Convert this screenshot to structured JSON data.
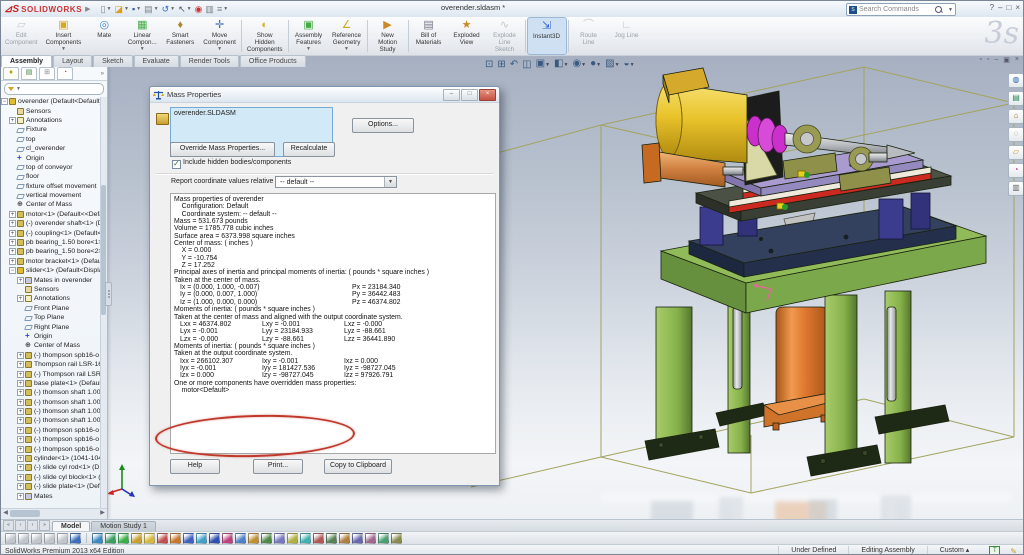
{
  "titlebar": {
    "logo_text": "SOLIDWORKS",
    "document_title": "overender.sldasm *",
    "search_placeholder": "Search Commands",
    "qat": [
      {
        "name": "new-document-icon",
        "dd": true
      },
      {
        "name": "open-document-icon",
        "dd": true
      },
      {
        "name": "save-icon",
        "dd": true
      },
      {
        "name": "print-icon",
        "dd": true
      },
      {
        "name": "undo-icon",
        "dd": true
      },
      {
        "name": "select-arrow-icon",
        "dd": true
      },
      {
        "name": "rebuild-icon",
        "dd": false
      },
      {
        "name": "file-properties-icon",
        "dd": false
      },
      {
        "name": "options-icon",
        "dd": true
      }
    ],
    "window_buttons": [
      {
        "name": "help-icon",
        "g": "?"
      },
      {
        "name": "minimize-icon",
        "g": "–"
      },
      {
        "name": "restore-icon",
        "g": "□"
      },
      {
        "name": "close-icon",
        "g": "×"
      }
    ]
  },
  "ribbon": {
    "brand_mark": "3s",
    "buttons": [
      {
        "label": "Edit\nComponent",
        "icon": "edit-component-icon",
        "enabled": false
      },
      {
        "label": "Insert\nComponents",
        "icon": "insert-components-icon",
        "dd": true
      },
      {
        "label": "Mate",
        "icon": "mate-icon"
      },
      {
        "label": "Linear\nCompon...",
        "icon": "linear-component-pattern-icon",
        "dd": true
      },
      {
        "label": "Smart\nFasteners",
        "icon": "smart-fasteners-icon"
      },
      {
        "label": "Move\nComponent",
        "icon": "move-component-icon",
        "dd": true,
        "sep": true
      },
      {
        "label": "Show\nHidden\nComponents",
        "icon": "show-hidden-components-icon",
        "sep": true
      },
      {
        "label": "Assembly\nFeatures",
        "icon": "assembly-features-icon",
        "dd": true
      },
      {
        "label": "Reference\nGeometry",
        "icon": "reference-geometry-icon",
        "dd": true,
        "sep": true
      },
      {
        "label": "New\nMotion\nStudy",
        "icon": "new-motion-study-icon",
        "sep": true
      },
      {
        "label": "Bill of\nMaterials",
        "icon": "bill-of-materials-icon"
      },
      {
        "label": "Exploded\nView",
        "icon": "exploded-view-icon"
      },
      {
        "label": "Explode\nLine\nSketch",
        "icon": "explode-line-sketch-icon",
        "enabled": false,
        "sep": true
      },
      {
        "label": "Instant3D",
        "icon": "instant3d-icon",
        "active": true,
        "sep": true
      },
      {
        "label": "Route\nLine",
        "icon": "route-line-icon",
        "enabled": false
      },
      {
        "label": "Jog Line",
        "icon": "jog-line-icon",
        "enabled": false
      }
    ]
  },
  "command_tabs": {
    "items": [
      "Assembly",
      "Layout",
      "Sketch",
      "Evaluate",
      "Render Tools",
      "Office Products"
    ],
    "active_index": 0
  },
  "headsup_icons": [
    {
      "name": "zoom-fit-icon",
      "g": "⊡"
    },
    {
      "name": "zoom-area-icon",
      "g": "⊞"
    },
    {
      "name": "previous-view-icon",
      "g": "↶"
    },
    {
      "name": "section-view-icon",
      "g": "◫"
    },
    {
      "name": "view-orientation-icon",
      "g": "▣",
      "dd": true
    },
    {
      "name": "display-style-icon",
      "g": "◧",
      "dd": true
    },
    {
      "name": "hide-show-items-icon",
      "g": "◉",
      "dd": true
    },
    {
      "name": "edit-appearance-icon",
      "g": "●",
      "dd": true
    },
    {
      "name": "apply-scene-icon",
      "g": "▨",
      "dd": true
    },
    {
      "name": "view-settings-icon",
      "g": "◒",
      "dd": true
    }
  ],
  "doc_window_buttons": [
    {
      "name": "new-window-icon",
      "g": "▫"
    },
    {
      "name": "cascade-windows-icon",
      "g": "▫"
    },
    {
      "name": "minimize-doc-icon",
      "g": "–"
    },
    {
      "name": "restore-doc-icon",
      "g": "▣"
    },
    {
      "name": "close-doc-icon",
      "g": "×"
    }
  ],
  "feature_panel": {
    "tabs": [
      "featuremanager-tab-icon",
      "propertymanager-tab-icon",
      "configurationmanager-tab-icon",
      "displaymanager-tab-icon"
    ],
    "tree": [
      {
        "t": "overender (Default<Default_[",
        "d": 0,
        "e": "-",
        "i": "asm"
      },
      {
        "t": "Sensors",
        "d": 1,
        "e": "",
        "i": "folder"
      },
      {
        "t": "Annotations",
        "d": 1,
        "e": "+",
        "i": "ann"
      },
      {
        "t": "Fixture",
        "d": 1,
        "e": "",
        "i": "plane"
      },
      {
        "t": "top",
        "d": 1,
        "e": "",
        "i": "plane"
      },
      {
        "t": "cl_overender",
        "d": 1,
        "e": "",
        "i": "plane"
      },
      {
        "t": "Origin",
        "d": 1,
        "e": "",
        "i": "origin"
      },
      {
        "t": "top of conveyor",
        "d": 1,
        "e": "",
        "i": "plane"
      },
      {
        "t": "floor",
        "d": 1,
        "e": "",
        "i": "plane"
      },
      {
        "t": "fixture offset movement",
        "d": 1,
        "e": "",
        "i": "plane"
      },
      {
        "t": "vertical movement",
        "d": 1,
        "e": "",
        "i": "plane"
      },
      {
        "t": "Center of Mass",
        "d": 1,
        "e": "",
        "i": "com"
      },
      {
        "t": "motor<1> (Default<<Defa",
        "d": 1,
        "e": "+",
        "i": "part"
      },
      {
        "t": "(-) overender shaft<1> (De",
        "d": 1,
        "e": "+",
        "i": "part"
      },
      {
        "t": "(-) coupling<1> (Default<",
        "d": 1,
        "e": "+",
        "i": "part"
      },
      {
        "t": "pb bearing_1.50 bore<1> (",
        "d": 1,
        "e": "+",
        "i": "part"
      },
      {
        "t": "pb bearing_1.50 bore<2> (",
        "d": 1,
        "e": "+",
        "i": "part"
      },
      {
        "t": "motor bracket<1> (Defaul",
        "d": 1,
        "e": "+",
        "i": "part"
      },
      {
        "t": "slider<1> (Default<Displa",
        "d": 1,
        "e": "-",
        "i": "asm"
      },
      {
        "t": "Mates in overender",
        "d": 2,
        "e": "+",
        "i": "mates"
      },
      {
        "t": "Sensors",
        "d": 2,
        "e": "",
        "i": "folder"
      },
      {
        "t": "Annotations",
        "d": 2,
        "e": "+",
        "i": "ann"
      },
      {
        "t": "Front Plane",
        "d": 2,
        "e": "",
        "i": "plane"
      },
      {
        "t": "Top Plane",
        "d": 2,
        "e": "",
        "i": "plane"
      },
      {
        "t": "Right Plane",
        "d": 2,
        "e": "",
        "i": "plane"
      },
      {
        "t": "Origin",
        "d": 2,
        "e": "",
        "i": "origin"
      },
      {
        "t": "Center of Mass",
        "d": 2,
        "e": "",
        "i": "com"
      },
      {
        "t": "(-) thompson spb16-o",
        "d": 2,
        "e": "+",
        "i": "part"
      },
      {
        "t": "Thompson rail LSR-16-",
        "d": 2,
        "e": "+",
        "i": "part"
      },
      {
        "t": "(-) Thompson rail LSR-",
        "d": 2,
        "e": "+",
        "i": "part"
      },
      {
        "t": "base plate<1> (Default",
        "d": 2,
        "e": "+",
        "i": "part"
      },
      {
        "t": "(-) thomson shaft 1.00",
        "d": 2,
        "e": "+",
        "i": "part"
      },
      {
        "t": "(-) thomson shaft 1.00",
        "d": 2,
        "e": "+",
        "i": "part"
      },
      {
        "t": "(-) thomson shaft 1.00",
        "d": 2,
        "e": "+",
        "i": "part"
      },
      {
        "t": "(-) thomson shaft 1.00",
        "d": 2,
        "e": "+",
        "i": "part"
      },
      {
        "t": "(-) thompson spb16-o",
        "d": 2,
        "e": "+",
        "i": "part"
      },
      {
        "t": "(-) thompson spb16-o",
        "d": 2,
        "e": "+",
        "i": "part"
      },
      {
        "t": "(-) thompson spb16-o",
        "d": 2,
        "e": "+",
        "i": "part"
      },
      {
        "t": "cylinder<1> (1041-104",
        "d": 2,
        "e": "+",
        "i": "part"
      },
      {
        "t": "(-) slide cyl rod<1> (D",
        "d": 2,
        "e": "+",
        "i": "part"
      },
      {
        "t": "(-) slide cyl block<1> (",
        "d": 2,
        "e": "+",
        "i": "part"
      },
      {
        "t": "(-) slide plate<1> (Def",
        "d": 2,
        "e": "+",
        "i": "part"
      },
      {
        "t": "Mates",
        "d": 2,
        "e": "+",
        "i": "mates"
      }
    ]
  },
  "task_pane_icons": [
    {
      "name": "solidworks-resources-icon",
      "g": "◍",
      "c": "#2a6ab0"
    },
    {
      "name": "design-library-icon",
      "g": "▤",
      "c": "#2a8a5a"
    },
    {
      "name": "file-explorer-icon",
      "g": "⌂",
      "c": "#9a6a2a"
    },
    {
      "name": "search-icon",
      "g": "◌",
      "c": "#4a7a3a"
    },
    {
      "name": "view-palette-icon",
      "g": "▱",
      "c": "#c89020"
    },
    {
      "name": "appearances-scenes-icon",
      "g": "◔",
      "c": "#b04090"
    },
    {
      "name": "custom-properties-icon",
      "g": "▥",
      "c": "#666"
    }
  ],
  "mass_dialog": {
    "title": "Mass Properties",
    "filename": "overender.SLDASM",
    "options_button": "Options...",
    "override_button": "Override Mass Properties...",
    "recalculate_button": "Recalculate",
    "include_hidden_label": "Include hidden bodies/components",
    "include_hidden_checked": true,
    "report_relative_label": "Report coordinate values relative to:",
    "report_relative_value": "-- default --",
    "help_button": "Help",
    "print_button": "Print...",
    "copy_button": "Copy to Clipboard",
    "report_lines": [
      "Mass properties of overender",
      "    Configuration: Default",
      "    Coordinate system: -- default --",
      "",
      "Mass = 531.673 pounds",
      "",
      "Volume = 1785.778 cubic inches",
      "",
      "Surface area = 6373.998 square inches",
      "",
      "Center of mass: ( inches )",
      "    X = 0.000",
      "    Y = -10.754",
      "    Z = 17.252",
      "",
      "Principal axes of inertia and principal moments of inertia: ( pounds * square inches )",
      "Taken at the center of mass.",
      {
        "cols2": [
          "Ix = (0.000, 1.000, -0.007)",
          "Px = 23184.340"
        ]
      },
      {
        "cols2": [
          "Iy = (0.000, 0.007, 1.000)",
          "Py = 36442.483"
        ]
      },
      {
        "cols2": [
          "Iz = (1.000, 0.000, 0.000)",
          "Pz = 46374.802"
        ]
      },
      "",
      "Moments of inertia: ( pounds * square inches )",
      "Taken at the center of mass and aligned with the output coordinate system.",
      {
        "cols3": [
          "Lxx = 46374.802",
          "Lxy = -0.001",
          "Lxz = -0.000"
        ]
      },
      {
        "cols3": [
          "Lyx = -0.001",
          "Lyy = 23184.933",
          "Lyz = -88.661"
        ]
      },
      {
        "cols3": [
          "Lzx = -0.000",
          "Lzy = -88.661",
          "Lzz = 36441.890"
        ]
      },
      "",
      "Moments of inertia: ( pounds * square inches )",
      "Taken at the output coordinate system.",
      {
        "cols3": [
          "Ixx = 266102.307",
          "Ixy = -0.001",
          "Ixz = 0.000"
        ]
      },
      {
        "cols3": [
          "Iyx = -0.001",
          "Iyy = 181427.536",
          "Iyz = -98727.045"
        ]
      },
      {
        "cols3": [
          "Izx = 0.000",
          "Izy = -98727.045",
          "Izz = 97926.791"
        ]
      },
      "",
      "One or more components have overridden mass properties:",
      "    motor<Default>"
    ]
  },
  "bottom_tabs": {
    "items": [
      "Model",
      "Motion Study 1"
    ],
    "active_index": 0
  },
  "selection_filter_toolbar": [
    {
      "name": "toggle-selection-filters-icon",
      "c": "#c0c6cc"
    },
    {
      "name": "clear-all-filters-icon",
      "c": "#c0c6cc"
    },
    {
      "name": "select-all-filters-icon",
      "c": "#c0c6cc"
    },
    {
      "name": "invert-selection-icon",
      "c": "#c0c6cc"
    },
    {
      "name": "power-select-icon",
      "c": "#c0c6cc"
    },
    {
      "name": "large-assembly-mode-icon",
      "c": "#3a6ec0"
    },
    {
      "name": "filter-vertices-icon",
      "c": "#3a8ac0"
    },
    {
      "name": "filter-edges-icon",
      "c": "#3aa060"
    },
    {
      "name": "filter-faces-icon",
      "c": "#38b048"
    },
    {
      "name": "filter-surface-bodies-icon",
      "c": "#c8a030"
    },
    {
      "name": "filter-solid-bodies-icon",
      "c": "#d8b83a"
    },
    {
      "name": "filter-axes-icon",
      "c": "#c05050"
    },
    {
      "name": "filter-planes-icon",
      "c": "#c87828"
    },
    {
      "name": "filter-sketch-points-icon",
      "c": "#4060c0"
    },
    {
      "name": "filter-sketch-segments-icon",
      "c": "#40a0c8"
    },
    {
      "name": "filter-midpoints-icon",
      "c": "#3050b0"
    },
    {
      "name": "filter-center-marks-icon",
      "c": "#c04080"
    },
    {
      "name": "filter-centerlines-icon",
      "c": "#5080c8"
    },
    {
      "name": "filter-dimensions-icon",
      "c": "#c09030"
    },
    {
      "name": "filter-annotations-icon",
      "c": "#508848"
    },
    {
      "name": "filter-notes-icon",
      "c": "#7878c0"
    },
    {
      "name": "filter-balloons-icon",
      "c": "#b0b040"
    },
    {
      "name": "filter-datums-icon",
      "c": "#40b0b0"
    },
    {
      "name": "filter-geometric-tolerances-icon",
      "c": "#b05858"
    },
    {
      "name": "filter-surface-finish-icon",
      "c": "#588058"
    },
    {
      "name": "filter-weld-symbols-icon",
      "c": "#b08040"
    },
    {
      "name": "filter-cosmetic-threads-icon",
      "c": "#6868b0"
    },
    {
      "name": "filter-blocks-icon",
      "c": "#a06890"
    },
    {
      "name": "filter-routing-points-icon",
      "c": "#48a070"
    },
    {
      "name": "filter-connection-points-icon",
      "c": "#8a8a50"
    }
  ],
  "statusbar": {
    "left": "SolidWorks Premium 2013 x64 Edition",
    "items": [
      "Under Defined",
      "Editing Assembly",
      "Custom"
    ],
    "custom_arrow": "▴"
  },
  "colors": {
    "accent_blue": "#cfe0f2",
    "model_frame_green": "#8fba55",
    "model_motor_yellow": "#e8c32a",
    "model_cylinder_orange": "#e07830",
    "model_coupling_magenta": "#cc30cc",
    "model_plate_navy": "#2e3a56",
    "model_slide_purple": "#a99bd0",
    "model_rail_red": "#cc2a20",
    "warning_ellipse_red": "#bf382b"
  }
}
